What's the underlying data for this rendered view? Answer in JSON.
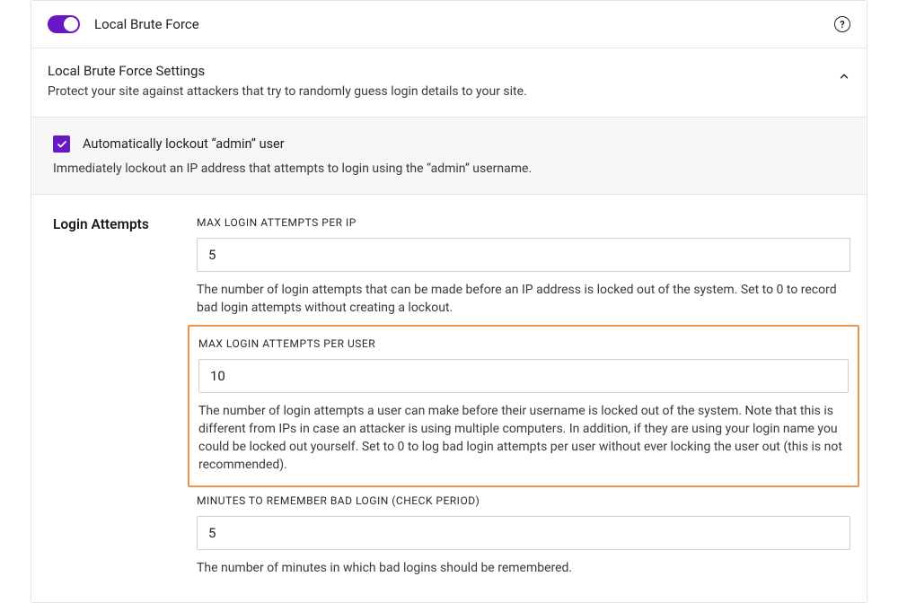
{
  "toggle": {
    "label": "Local Brute Force",
    "enabled": true
  },
  "settings": {
    "title": "Local Brute Force Settings",
    "description": "Protect your site against attackers that try to randomly guess login details to your site."
  },
  "admin_lockout": {
    "checked": true,
    "label": "Automatically lockout “admin” user",
    "description": "Immediately lockout an IP address that attempts to login using the “admin” username."
  },
  "login_attempts": {
    "group_label": "Login Attempts",
    "fields": [
      {
        "label": "MAX LOGIN ATTEMPTS PER IP",
        "value": "5",
        "help": "The number of login attempts that can be made before an IP address is locked out of the system. Set to 0 to record bad login attempts without creating a lockout."
      },
      {
        "label": "MAX LOGIN ATTEMPTS PER USER",
        "value": "10",
        "help": "The number of login attempts a user can make before their username is locked out of the system. Note that this is different from IPs in case an attacker is using multiple computers. In addition, if they are using your login name you could be locked out yourself. Set to 0 to log bad login attempts per user without ever locking the user out (this is not recommended)."
      },
      {
        "label": "MINUTES TO REMEMBER BAD LOGIN (CHECK PERIOD)",
        "value": "5",
        "help": "The number of minutes in which bad logins should be remembered."
      }
    ]
  }
}
